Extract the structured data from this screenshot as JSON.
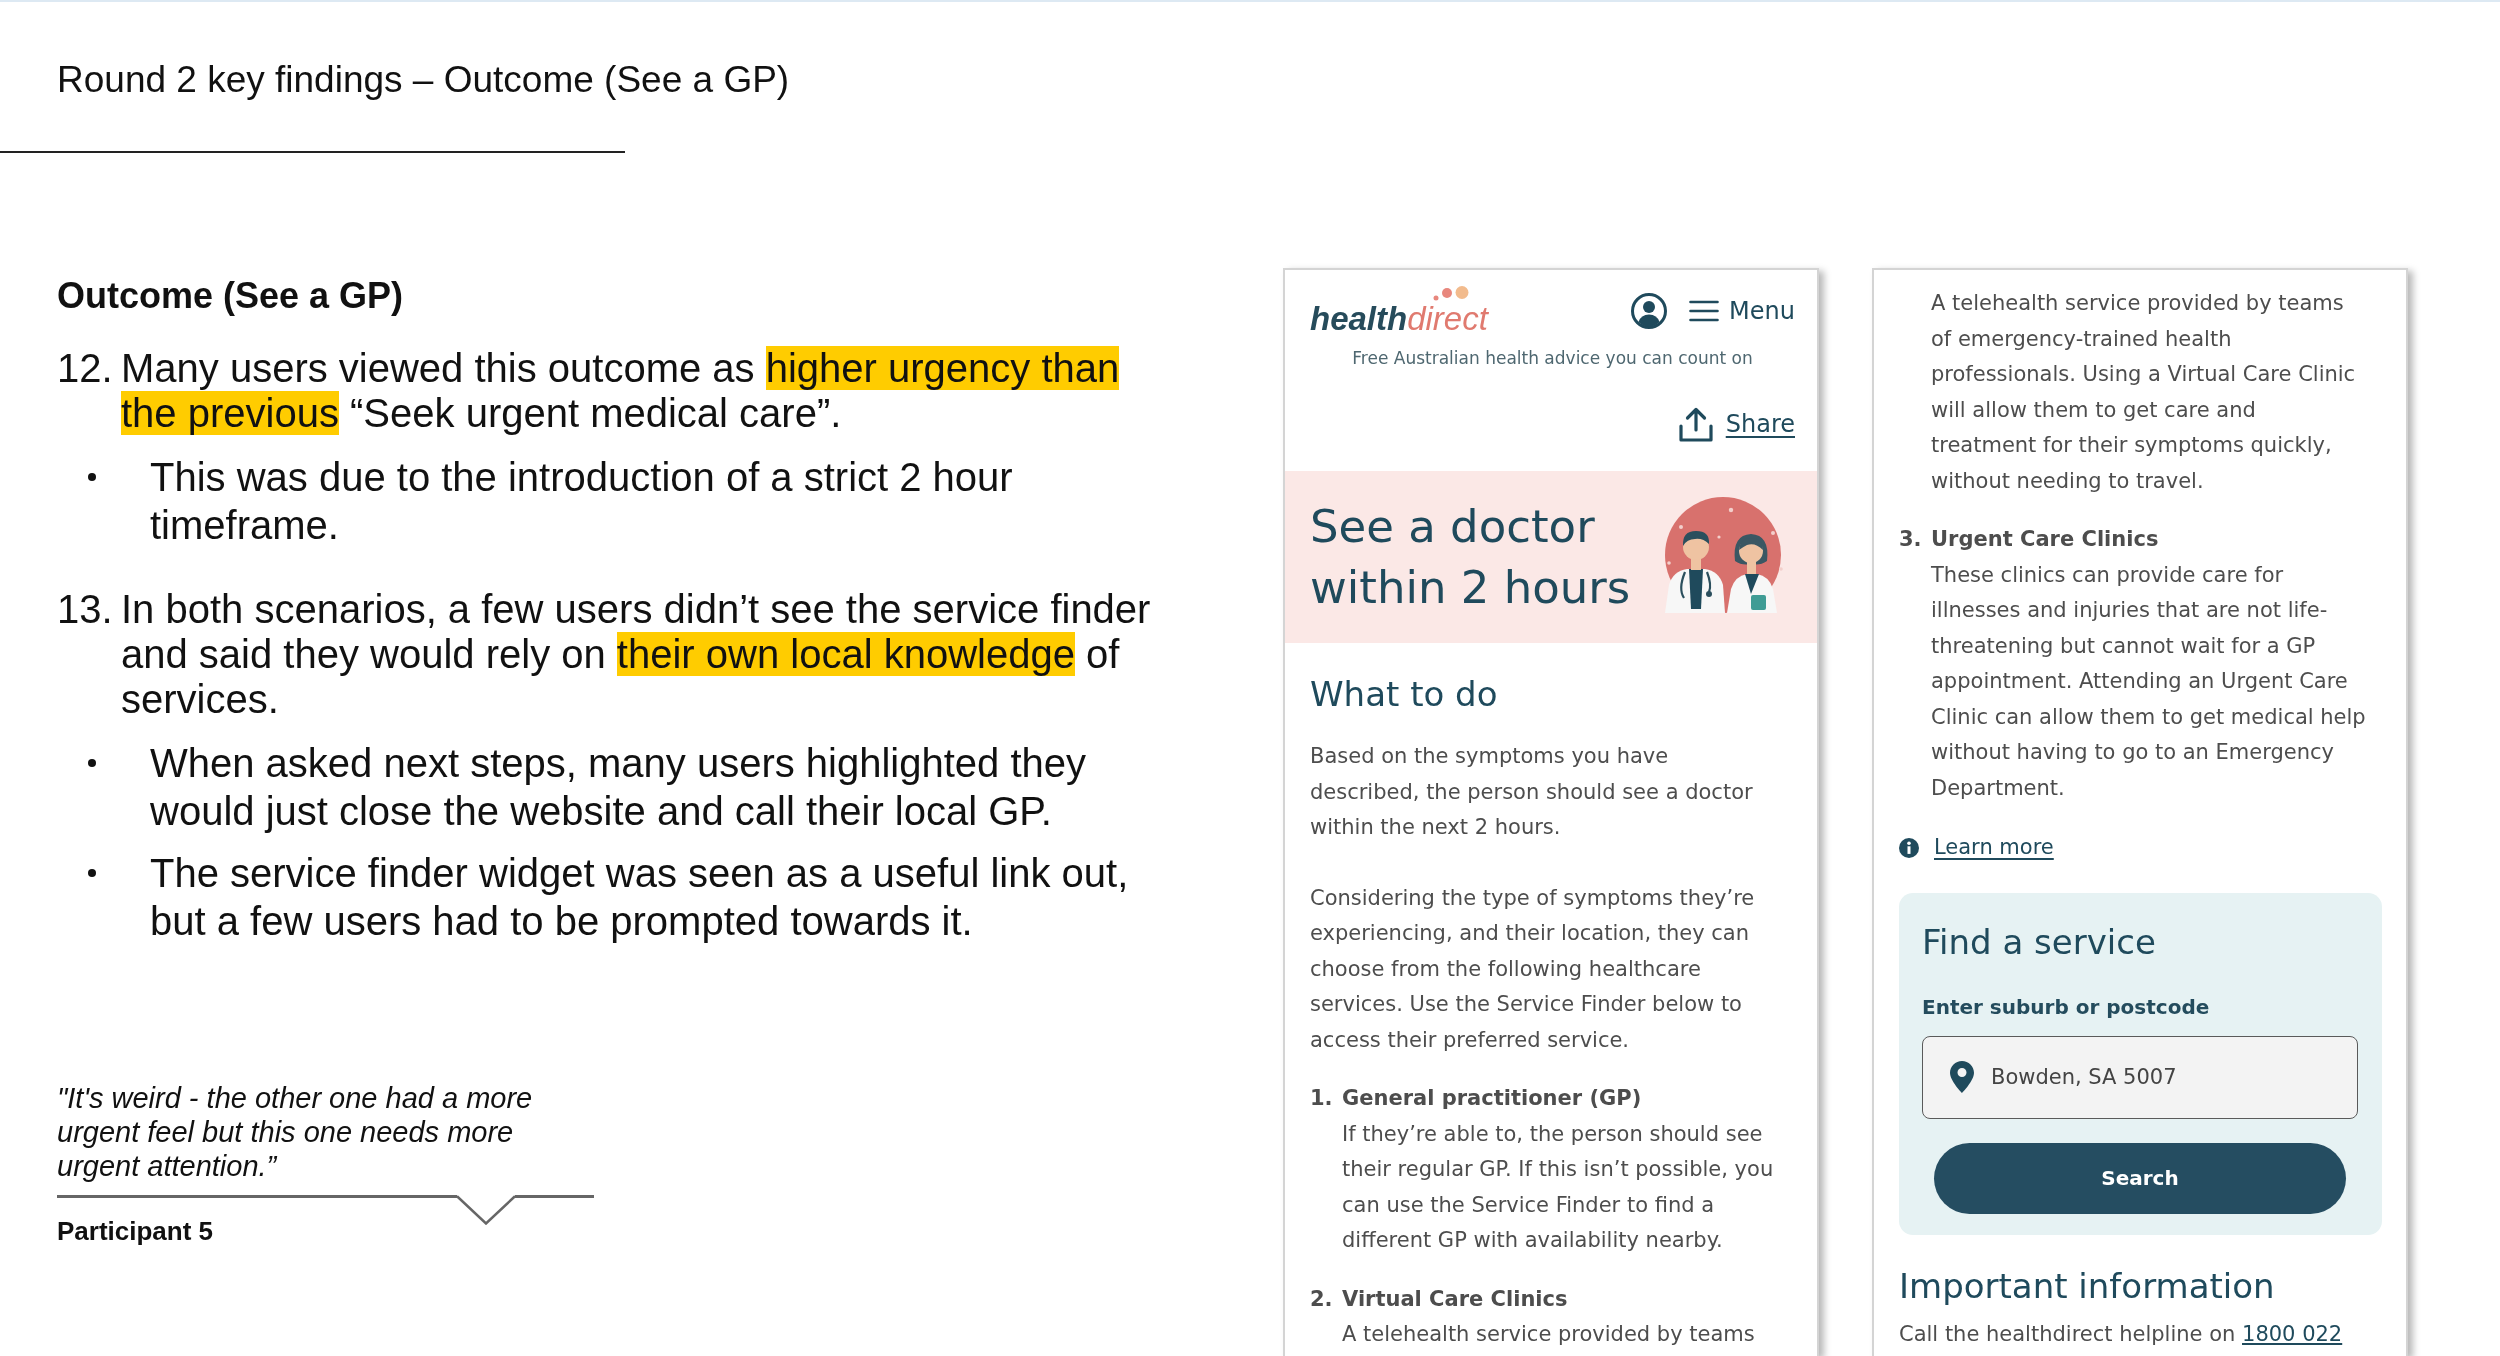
{
  "slide": {
    "title": "Round 2 key findings – Outcome (See a GP)"
  },
  "findings": {
    "heading": "Outcome (See a GP)",
    "items": [
      {
        "number": "12.",
        "segments": [
          {
            "text": "Many users viewed this outcome as ",
            "highlighted": false
          },
          {
            "text": "higher urgency than the previous",
            "highlighted": true
          },
          {
            "text": " “Seek urgent medical care”.",
            "highlighted": false
          }
        ],
        "bullets": [
          "This was due to the introduction of a strict 2 hour timeframe."
        ]
      },
      {
        "number": "13.",
        "segments": [
          {
            "text": "In both scenarios, a few users didn’t see the service finder and said they would rely on ",
            "highlighted": false
          },
          {
            "text": "their own local knowledge",
            "highlighted": true
          },
          {
            "text": " of services.",
            "highlighted": false
          }
        ],
        "bullets": [
          "When asked next steps, many users highlighted they would just close the website and call their local GP.",
          "The service finder widget was seen as a useful link out, but a few users had to be prompted towards it."
        ]
      }
    ]
  },
  "quote": {
    "text": "\"It's weird - the other one had a more urgent feel but this one needs more urgent attention.”",
    "attribution": "Participant 5"
  },
  "phone_screens": [
    {
      "blocks": [
        {
          "kind": "site_header",
          "logo": "**health**direct",
          "menu_label": "Menu",
          "tagline": "Free Australian health advice you can count on"
        },
        {
          "kind": "share",
          "label": "Share"
        },
        {
          "kind": "hero",
          "title": "See a doctor within 2 hours"
        },
        {
          "kind": "heading",
          "text": "What to do"
        },
        {
          "kind": "paragraph",
          "text": "Based on the symptoms you have described, the person should see a doctor within the next 2 hours."
        },
        {
          "kind": "paragraph",
          "text": "Considering the type of symptoms they’re experiencing, and their location, they can choose from the following healthcare services. Use the Service Finder below to access their preferred service."
        },
        {
          "kind": "numbered_item",
          "number": "1.",
          "title": "General practitioner (GP)",
          "text": "If they’re able to, the person should see their regular GP. If this isn’t possible, you can use the Service Finder to find a different GP with availability nearby."
        },
        {
          "kind": "numbered_item",
          "number": "2.",
          "title": "Virtual Care Clinics",
          "text": "A telehealth service provided by teams"
        }
      ]
    },
    {
      "blocks": [
        {
          "kind": "item_continuation",
          "text": "A telehealth service provided by teams of emergency-trained health professionals. Using a Virtual Care Clinic will allow them to get care and treatment for their symptoms quickly, without needing to travel."
        },
        {
          "kind": "numbered_item",
          "number": "3.",
          "title": "Urgent Care Clinics",
          "text": "These clinics can provide care for illnesses and injuries that are not life-threatening but cannot wait for a GP appointment. Attending an Urgent Care Clinic can allow them to get medical help without having to go to an Emergency Department."
        },
        {
          "kind": "info_link",
          "label": "Learn more"
        },
        {
          "kind": "service_finder",
          "title": "Find a service",
          "field_label": "Enter suburb or postcode",
          "value": "Bowden, SA 5007",
          "button": "Search"
        },
        {
          "kind": "heading",
          "text": "Important information"
        },
        {
          "kind": "link_paragraph",
          "text": "Call the healthdirect helpline on ",
          "link": "1800 022"
        }
      ]
    }
  ]
}
